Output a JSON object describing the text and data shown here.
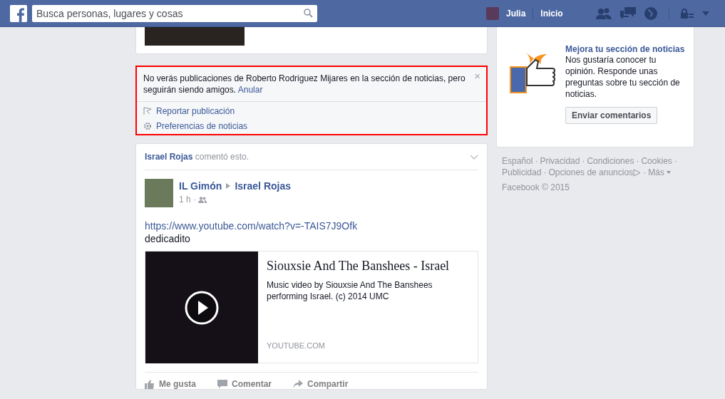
{
  "header": {
    "search": {
      "placeholder": "Busca personas, lugares y cosas"
    },
    "user_name": "Julia",
    "home_link": "Inicio"
  },
  "feed": {
    "hidden_notice": {
      "highlighted": true,
      "message": "No verás publicaciones de Roberto Rodriguez Mijares en la sección de noticias, pero seguirán siendo amigos.",
      "undo_link": "Anular",
      "close": "×",
      "actions": [
        {
          "kind": "report",
          "label": "Reportar publicación"
        },
        {
          "kind": "preferences",
          "label": "Preferencias de noticias"
        }
      ]
    },
    "post": {
      "activity_actor": "Israel Rojas",
      "activity_text": "comentó esto.",
      "author": "IL Gimón",
      "target": "Israel Rojas",
      "time": "1 h",
      "time_separator": "·",
      "link": "https://www.youtube.com/watch?v=-TAIS7J9Ofk",
      "text": "dedicadito",
      "attachment": {
        "title": "Siouxsie And The Banshees - Israel",
        "description": "Music video by Siouxsie And The Banshees performing Israel. (c) 2014 UMC",
        "domain": "YOUTUBE.COM"
      },
      "actions": [
        {
          "kind": "like",
          "label": "Me gusta"
        },
        {
          "kind": "comment",
          "label": "Comentar"
        },
        {
          "kind": "share",
          "label": "Compartir"
        }
      ]
    }
  },
  "sidebar": {
    "promo": {
      "title": "Mejora tu sección de noticias",
      "body": "Nos gustaría conocer tu opinión. Responde unas preguntas sobre tu sección de noticias.",
      "button": "Enviar comentarios"
    },
    "footer_links": [
      "Español",
      "Privacidad",
      "Condiciones",
      "Cookies",
      "Publicidad",
      "Opciones de anuncios",
      "Más"
    ],
    "separator": "·",
    "copyright": "Facebook © 2015"
  }
}
